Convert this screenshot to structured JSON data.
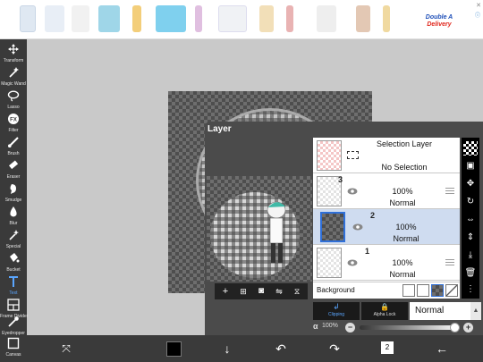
{
  "ad": {
    "brand_line1": "Double A",
    "brand_line2": "Delivery",
    "info_icon": "info-icon",
    "close_icon": "close-icon"
  },
  "toolbar": {
    "items": [
      {
        "label": "Transform",
        "icon": "move-icon"
      },
      {
        "label": "Magic Wand",
        "icon": "magic-wand-icon"
      },
      {
        "label": "Lasso",
        "icon": "lasso-icon"
      },
      {
        "label": "Filter",
        "icon": "fx-icon"
      },
      {
        "label": "Brush",
        "icon": "brush-icon"
      },
      {
        "label": "Eraser",
        "icon": "eraser-icon"
      },
      {
        "label": "Smudge",
        "icon": "smudge-icon"
      },
      {
        "label": "Blur",
        "icon": "blur-icon"
      },
      {
        "label": "Special",
        "icon": "sparkle-icon"
      },
      {
        "label": "Bucket",
        "icon": "bucket-icon"
      },
      {
        "label": "Text",
        "icon": "text-icon"
      },
      {
        "label": "Frame Divider",
        "icon": "frame-icon"
      },
      {
        "label": "Eyedropper",
        "icon": "eyedropper-icon"
      },
      {
        "label": "Canvas",
        "icon": "canvas-icon"
      }
    ],
    "active": "Text",
    "active_color": "#5aa6ff"
  },
  "layer_panel": {
    "title": "Layer",
    "selection_layer": {
      "title": "Selection Layer",
      "subtitle": "No Selection"
    },
    "layers": [
      {
        "number": "3",
        "opacity": "100%",
        "mode": "Normal",
        "selected": false
      },
      {
        "number": "2",
        "opacity": "100%",
        "mode": "Normal",
        "selected": true
      },
      {
        "number": "1",
        "opacity": "100%",
        "mode": "Normal",
        "selected": false
      }
    ],
    "background_label": "Background",
    "clipping_label": "Clipping",
    "alpha_lock_label": "Alpha Lock",
    "blend_mode": "Normal",
    "alpha_symbol": "α",
    "alpha_value": "100%",
    "alpha_level": 1.0,
    "minus": "−",
    "plus": "+"
  },
  "preview_tools": [
    "plus-icon",
    "add-layer-icon",
    "camera-icon",
    "flip-icon",
    "merge-icon"
  ],
  "side_tools": [
    "checker-icon",
    "transform-layer-icon",
    "move-icon",
    "rotate-icon",
    "flip-horizontal-icon",
    "flip-vertical-icon",
    "merge-down-icon",
    "trash-icon",
    "more-icon"
  ],
  "bottom_bar": {
    "page_count": "2",
    "icons": [
      "quick-menu-icon",
      "color-swatch-icon",
      "download-icon",
      "undo-icon",
      "redo-icon",
      "layers-icon",
      "back-icon"
    ]
  },
  "colors": {
    "toolbar_bg": "#3a3a3a",
    "panel_bg": "#4b4b4b",
    "selected_row": "#cfdcf0",
    "accent": "#2f6fd8"
  }
}
